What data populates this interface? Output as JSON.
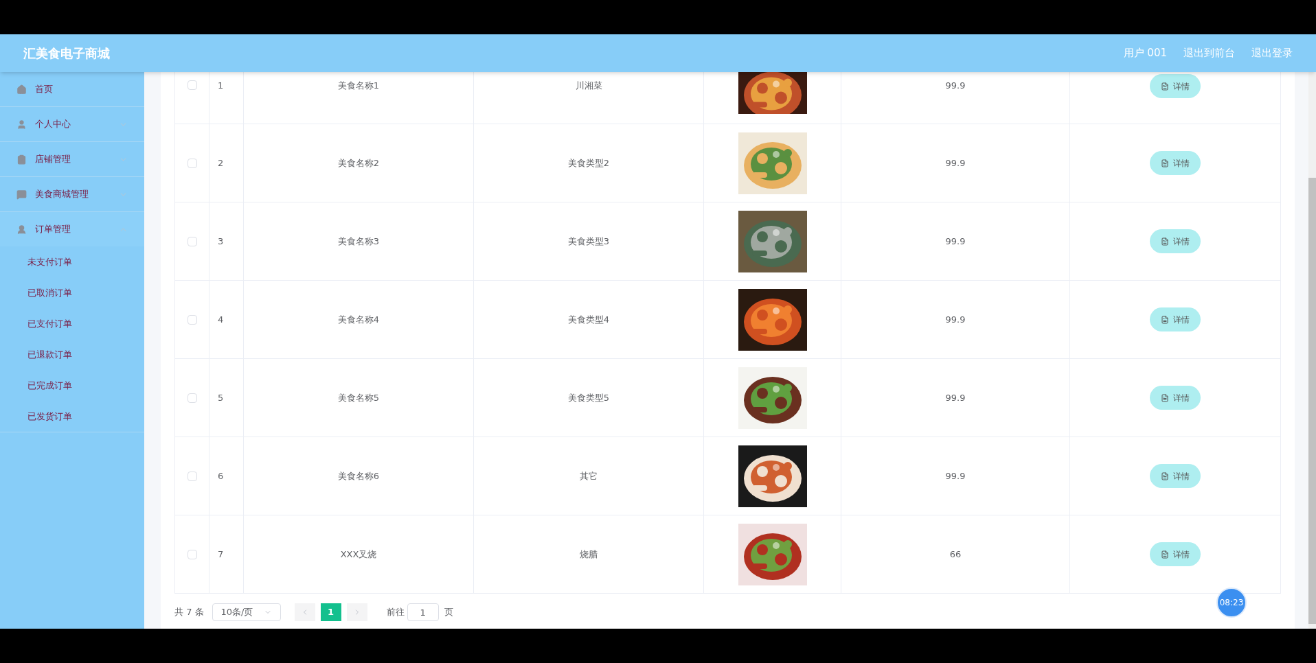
{
  "header": {
    "title": "汇美食电子商城",
    "links": [
      "用户 001",
      "退出到前台",
      "退出登录"
    ]
  },
  "sidebar": {
    "items": [
      {
        "label": "首页",
        "expandable": false
      },
      {
        "label": "个人中心",
        "expandable": true,
        "expanded": false
      },
      {
        "label": "店铺管理",
        "expandable": true,
        "expanded": false
      },
      {
        "label": "美食商城管理",
        "expandable": true,
        "expanded": false
      },
      {
        "label": "订单管理",
        "expandable": true,
        "expanded": true,
        "children": [
          {
            "label": "未支付订单"
          },
          {
            "label": "已取消订单"
          },
          {
            "label": "已支付订单"
          },
          {
            "label": "已退款订单"
          },
          {
            "label": "已完成订单"
          },
          {
            "label": "已发货订单"
          }
        ]
      }
    ]
  },
  "table": {
    "rows": [
      {
        "checked": false,
        "index": "1",
        "name": "美食名称1",
        "type": "川湘菜",
        "price": "99.9",
        "action": "详情"
      },
      {
        "checked": false,
        "index": "2",
        "name": "美食名称2",
        "type": "美食类型2",
        "price": "99.9",
        "action": "详情"
      },
      {
        "checked": false,
        "index": "3",
        "name": "美食名称3",
        "type": "美食类型3",
        "price": "99.9",
        "action": "详情"
      },
      {
        "checked": false,
        "index": "4",
        "name": "美食名称4",
        "type": "美食类型4",
        "price": "99.9",
        "action": "详情"
      },
      {
        "checked": false,
        "index": "5",
        "name": "美食名称5",
        "type": "美食类型5",
        "price": "99.9",
        "action": "详情"
      },
      {
        "checked": false,
        "index": "6",
        "name": "美食名称6",
        "type": "其它",
        "price": "99.9",
        "action": "详情"
      },
      {
        "checked": false,
        "index": "7",
        "name": "XXX叉烧",
        "type": "烧腊",
        "price": "66",
        "action": "详情"
      }
    ]
  },
  "pagination": {
    "total": "共 7 条",
    "page_size": "10条/页",
    "pages": [
      {
        "label": "1",
        "selected": true
      }
    ],
    "goto_label": "前往",
    "goto_value": "1",
    "goto_suffix": "页"
  },
  "clock": "08:23"
}
